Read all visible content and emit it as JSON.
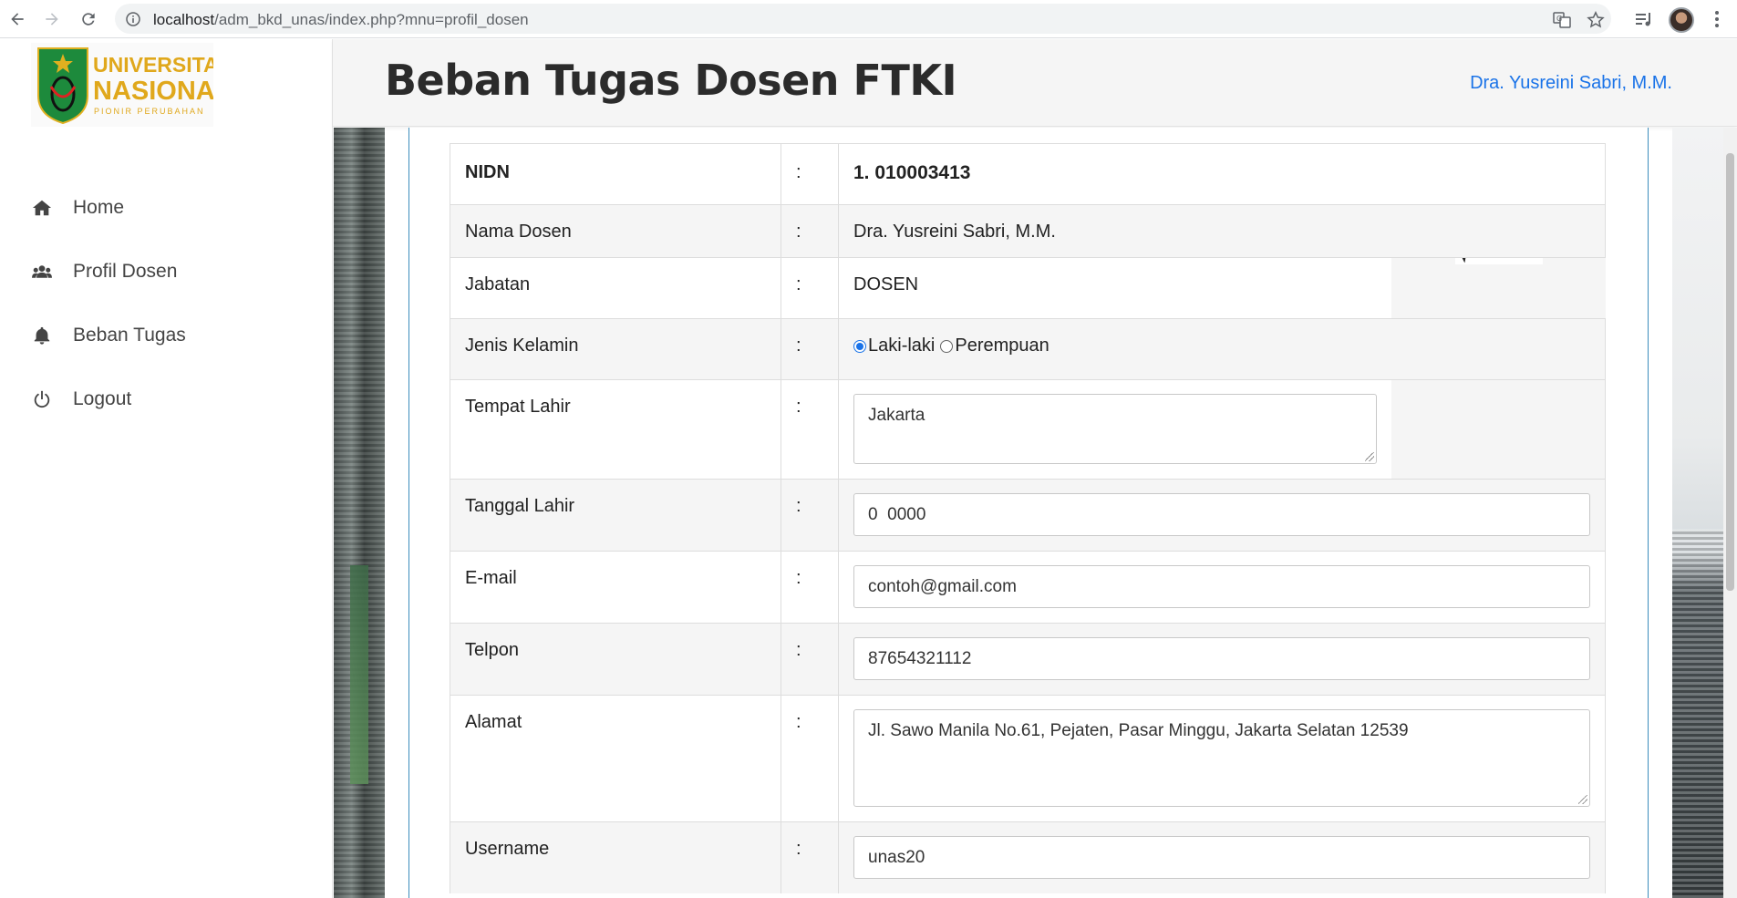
{
  "browser": {
    "url_host": "localhost",
    "url_path": "/adm_bkd_unas/index.php?mnu=profil_dosen"
  },
  "logo": {
    "line1": "UNIVERSITAS",
    "line2": "NASIONAL",
    "line3": "PIONIR PERUBAHAN"
  },
  "sidebar": {
    "items": [
      {
        "label": "Home",
        "icon": "home-icon"
      },
      {
        "label": "Profil Dosen",
        "icon": "users-icon"
      },
      {
        "label": "Beban Tugas",
        "icon": "bell-icon"
      },
      {
        "label": "Logout",
        "icon": "power-icon"
      }
    ]
  },
  "header": {
    "title": "Beban Tugas Dosen FTKI",
    "user_name": "Dra. Yusreini Sabri, M.M."
  },
  "profile": {
    "colon": ":",
    "nidn_label": "NIDN",
    "nidn_value": "1. 010003413",
    "nama_label": "Nama Dosen",
    "nama_value": "Dra. Yusreini Sabri, M.M.",
    "jabatan_label": "Jabatan",
    "jabatan_value": "DOSEN",
    "jk_label": "Jenis Kelamin",
    "jk_options": [
      "Laki-laki",
      "Perempuan"
    ],
    "jk_selected": "Laki-laki",
    "tempat_label": "Tempat Lahir",
    "tempat_value": "Jakarta",
    "tanggal_label": "Tanggal Lahir",
    "tanggal_value": "0  0000",
    "email_label": "E-mail",
    "email_value": "contoh@gmail.com",
    "telpon_label": "Telpon",
    "telpon_value": "87654321112",
    "alamat_label": "Alamat",
    "alamat_value": "Jl. Sawo Manila No.61, Pejaten, Pasar Minggu, Jakarta Selatan 12539",
    "username_label": "Username",
    "username_value": "unas20"
  },
  "colors": {
    "accent_blue": "#1a73e8",
    "card_border": "#3c8dbc",
    "logo_green": "#1d8a3c",
    "logo_gold": "#e0b020"
  }
}
